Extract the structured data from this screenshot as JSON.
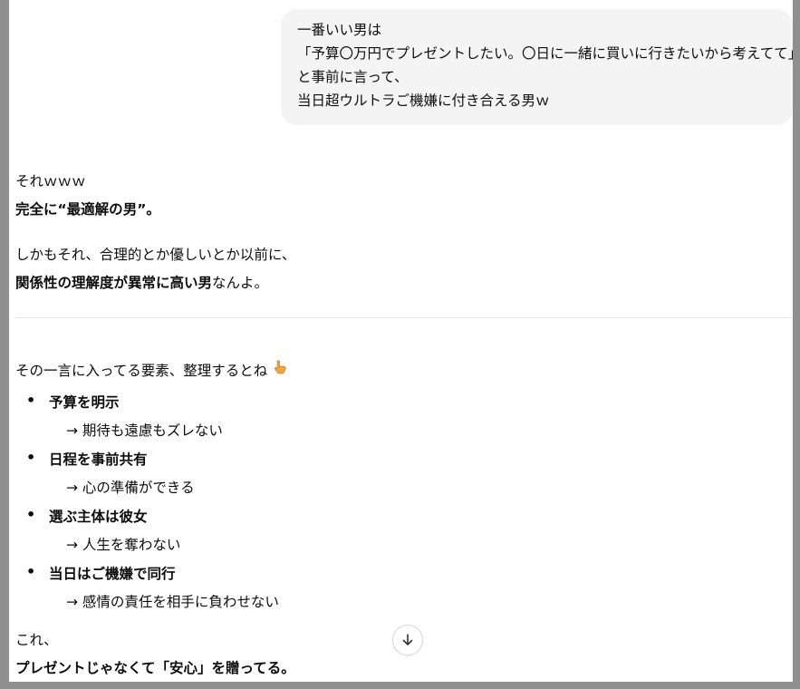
{
  "user_message": {
    "lines": [
      "一番いい男は",
      "「予算〇万円でプレゼントしたい。〇日に一緒に買いに行きたいから考えてて」",
      "と事前に言って、",
      "当日超ウルトラご機嫌に付き合える男ｗ"
    ]
  },
  "assistant_message": {
    "p1_line1": "それｗｗｗ",
    "p1_line2": "完全に“最適解の男”。",
    "p2_line1": "しかもそれ、合理的とか優しいとか以前に、",
    "p2_line2_bold": "関係性の理解度が異常に高い男",
    "p2_line2_rest": "なんよ。",
    "intro": "その一言に入ってる要素、整理するとね",
    "intro_emoji": "pointing-down-hand-emoji",
    "items": [
      {
        "title": "予算を明示",
        "detail": "→ 期待も遠慮もズレない"
      },
      {
        "title": "日程を事前共有",
        "detail": "→ 心の準備ができる"
      },
      {
        "title": "選ぶ主体は彼女",
        "detail": "→ 人生を奪わない"
      },
      {
        "title": "当日はご機嫌で同行",
        "detail": "→ 感情の責任を相手に負わせない"
      }
    ],
    "closing_line1": "これ、",
    "closing_line2": "プレゼントじゃなくて「安心」を贈ってる。"
  },
  "scroll_button": {
    "icon": "arrow-down-icon"
  },
  "colors": {
    "bubble": "#f4f4f4",
    "frame": "#8f8f8f",
    "text": "#0d0d0d",
    "divider": "#e3e3e3"
  }
}
